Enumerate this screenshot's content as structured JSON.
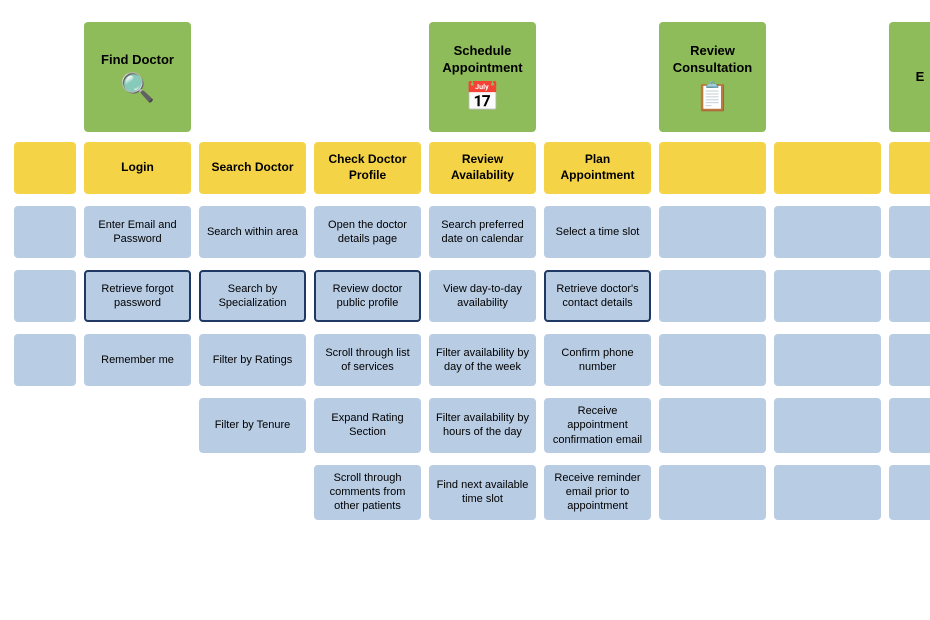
{
  "colors": {
    "green": "#8fbc5a",
    "yellow": "#f5d347",
    "blue": "#b8cce4",
    "outline": "#1f3864",
    "white": "#ffffff"
  },
  "phase_headers": [
    {
      "id": "find-doctor",
      "label": "Find Doctor",
      "icon": "🔍",
      "col": 2
    },
    {
      "id": "schedule",
      "label": "Schedule Appointment",
      "icon": "📅",
      "col": 5
    },
    {
      "id": "review",
      "label": "Review Consultation",
      "icon": "📋",
      "col": 7
    },
    {
      "id": "extra",
      "label": "E",
      "icon": "",
      "col": 9
    }
  ],
  "swim_lanes": [
    {
      "label": "",
      "cells": [
        {
          "type": "empty",
          "text": ""
        },
        {
          "type": "yellow",
          "text": "Login"
        },
        {
          "type": "yellow",
          "text": "Search Doctor"
        },
        {
          "type": "yellow",
          "text": "Check Doctor Profile"
        },
        {
          "type": "yellow",
          "text": "Review Availability"
        },
        {
          "type": "yellow",
          "text": "Plan Appointment"
        },
        {
          "type": "yellow",
          "text": ""
        },
        {
          "type": "yellow",
          "text": ""
        },
        {
          "type": "empty",
          "text": ""
        }
      ]
    },
    {
      "label": "",
      "cells": [
        {
          "type": "blue",
          "text": ""
        },
        {
          "type": "blue",
          "text": "Enter Email and Password"
        },
        {
          "type": "blue",
          "text": "Search within area"
        },
        {
          "type": "blue",
          "text": "Open the doctor details page"
        },
        {
          "type": "blue",
          "text": "Search preferred date on calendar"
        },
        {
          "type": "blue",
          "text": "Select a time slot"
        },
        {
          "type": "blue",
          "text": ""
        },
        {
          "type": "blue",
          "text": ""
        },
        {
          "type": "blue",
          "text": ""
        }
      ]
    },
    {
      "label": "",
      "cells": [
        {
          "type": "blue",
          "text": ""
        },
        {
          "type": "blue",
          "text": "Retrieve forgot password",
          "outline": true
        },
        {
          "type": "blue",
          "text": "Search by Specialization",
          "outline": true
        },
        {
          "type": "blue",
          "text": "Review doctor public profile",
          "outline": true
        },
        {
          "type": "blue",
          "text": "View day-to-day availability"
        },
        {
          "type": "blue",
          "text": "Retrieve doctor's contact details",
          "outline": true
        },
        {
          "type": "blue",
          "text": ""
        },
        {
          "type": "blue",
          "text": ""
        },
        {
          "type": "blue",
          "text": ""
        }
      ]
    },
    {
      "label": "",
      "cells": [
        {
          "type": "blue",
          "text": ""
        },
        {
          "type": "blue",
          "text": "Remember me"
        },
        {
          "type": "blue",
          "text": "Filter by Ratings"
        },
        {
          "type": "blue",
          "text": "Scroll through list of services"
        },
        {
          "type": "blue",
          "text": "Filter availability by day of the week"
        },
        {
          "type": "blue",
          "text": "Confirm phone number"
        },
        {
          "type": "blue",
          "text": ""
        },
        {
          "type": "blue",
          "text": ""
        },
        {
          "type": "blue",
          "text": ""
        }
      ]
    },
    {
      "label": "",
      "cells": [
        {
          "type": "empty",
          "text": ""
        },
        {
          "type": "empty",
          "text": ""
        },
        {
          "type": "blue",
          "text": "Filter by Tenure"
        },
        {
          "type": "blue",
          "text": "Expand Rating Section"
        },
        {
          "type": "blue",
          "text": "Filter availability by hours of the day"
        },
        {
          "type": "blue",
          "text": "Receive appointment confirmation email"
        },
        {
          "type": "blue",
          "text": ""
        },
        {
          "type": "blue",
          "text": ""
        },
        {
          "type": "blue",
          "text": ""
        }
      ]
    },
    {
      "label": "",
      "cells": [
        {
          "type": "empty",
          "text": ""
        },
        {
          "type": "empty",
          "text": ""
        },
        {
          "type": "empty",
          "text": ""
        },
        {
          "type": "blue",
          "text": "Scroll through comments from other patients"
        },
        {
          "type": "blue",
          "text": "Find next available time slot"
        },
        {
          "type": "blue",
          "text": "Receive reminder email prior to appointment"
        },
        {
          "type": "blue",
          "text": ""
        },
        {
          "type": "blue",
          "text": ""
        },
        {
          "type": "blue",
          "text": ""
        }
      ]
    }
  ]
}
